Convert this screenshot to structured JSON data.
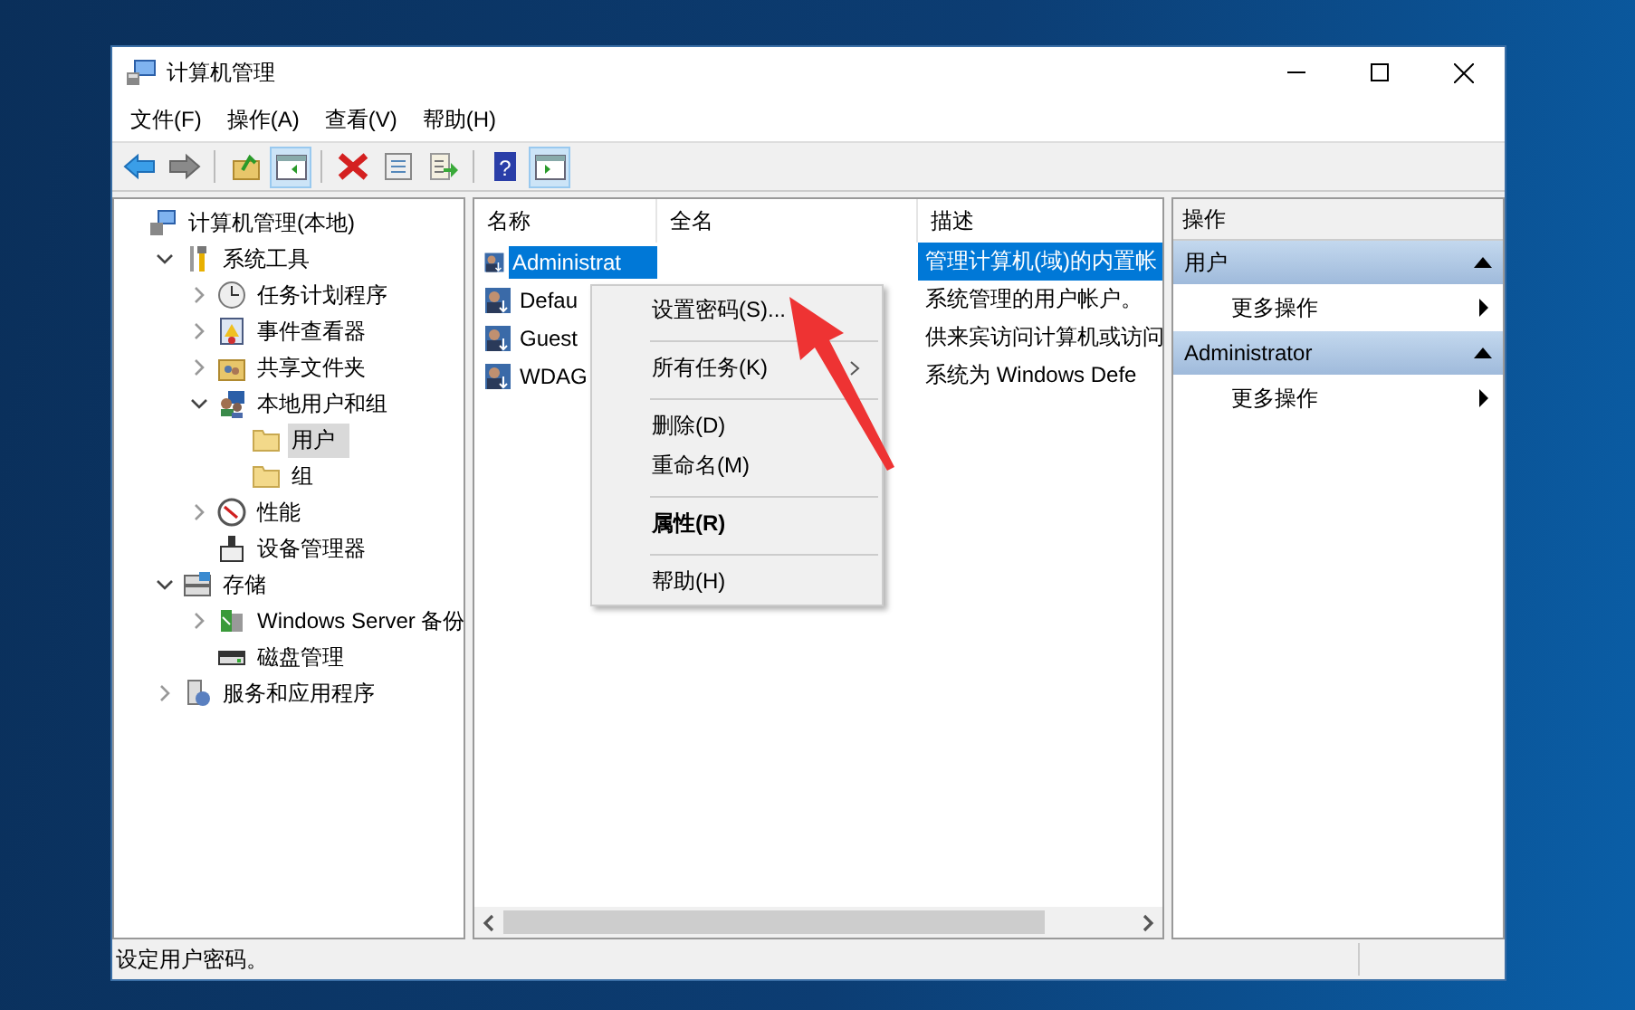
{
  "window": {
    "title": "计算机管理"
  },
  "menu": [
    "文件(F)",
    "操作(A)",
    "查看(V)",
    "帮助(H)"
  ],
  "toolbar": [
    {
      "kind": "back",
      "pressed": false
    },
    {
      "kind": "forward",
      "pressed": false
    },
    {
      "kind": "up",
      "pressed": false
    },
    {
      "kind": "tree-toggle",
      "pressed": true
    },
    {
      "kind": "delete",
      "pressed": false
    },
    {
      "kind": "properties",
      "pressed": false
    },
    {
      "kind": "export",
      "pressed": false
    },
    {
      "kind": "help",
      "label": "?",
      "pressed": false
    },
    {
      "kind": "action-toggle",
      "pressed": true
    }
  ],
  "tree": [
    {
      "label": "计算机管理(本地)",
      "kind": "computer",
      "selected": false,
      "children": [
        {
          "label": "系统工具",
          "kind": "tools",
          "expanded": true,
          "selected": false,
          "children": [
            {
              "label": "任务计划程序",
              "kind": "clock",
              "expanded": false,
              "selected": false
            },
            {
              "label": "事件查看器",
              "kind": "log",
              "expanded": false,
              "selected": false
            },
            {
              "label": "共享文件夹",
              "kind": "share",
              "expanded": false,
              "selected": false
            },
            {
              "label": "本地用户和组",
              "kind": "users",
              "expanded": true,
              "selected": false,
              "children": [
                {
                  "label": "用户",
                  "kind": "folder",
                  "selected": true
                },
                {
                  "label": "组",
                  "kind": "folder",
                  "selected": false
                }
              ]
            },
            {
              "label": "性能",
              "kind": "gauge",
              "expanded": false,
              "selected": false
            },
            {
              "label": "设备管理器",
              "kind": "device",
              "selected": false
            }
          ]
        },
        {
          "label": "存储",
          "kind": "storage",
          "expanded": true,
          "selected": false,
          "children": [
            {
              "label": "Windows Server 备份",
              "kind": "backup",
              "expanded": false,
              "selected": false
            },
            {
              "label": "磁盘管理",
              "kind": "disk",
              "selected": false
            }
          ]
        },
        {
          "label": "服务和应用程序",
          "kind": "services",
          "expanded": false,
          "selected": false
        }
      ]
    }
  ],
  "list": {
    "columns": [
      "名称",
      "全名",
      "描述"
    ],
    "rows": [
      {
        "name": "Administrat",
        "description": "管理计算机(域)的内置帐",
        "selected": true
      },
      {
        "name": "Defau",
        "description": "系统管理的用户帐户。",
        "selected": false
      },
      {
        "name": "Guest",
        "description": "供来宾访问计算机或访问",
        "selected": false
      },
      {
        "name": "WDAG",
        "description": "系统为 Windows Defe",
        "selected": false
      }
    ]
  },
  "context_menu": [
    {
      "label": "设置密码(S)...",
      "bold": false,
      "submenu": false,
      "separator_after": true
    },
    {
      "label": "所有任务(K)",
      "bold": false,
      "submenu": true,
      "separator_after": true
    },
    {
      "label": "删除(D)",
      "bold": false,
      "submenu": false,
      "separator_after": false
    },
    {
      "label": "重命名(M)",
      "bold": false,
      "submenu": false,
      "separator_after": true
    },
    {
      "label": "属性(R)",
      "bold": true,
      "submenu": false,
      "separator_after": true
    },
    {
      "label": "帮助(H)",
      "bold": false,
      "submenu": false,
      "separator_after": false
    }
  ],
  "actions": {
    "title": "操作",
    "sections": [
      {
        "title": "用户",
        "items": [
          "更多操作"
        ]
      },
      {
        "title": "Administrator",
        "items": [
          "更多操作"
        ]
      }
    ]
  },
  "status_bar": "设定用户密码。"
}
